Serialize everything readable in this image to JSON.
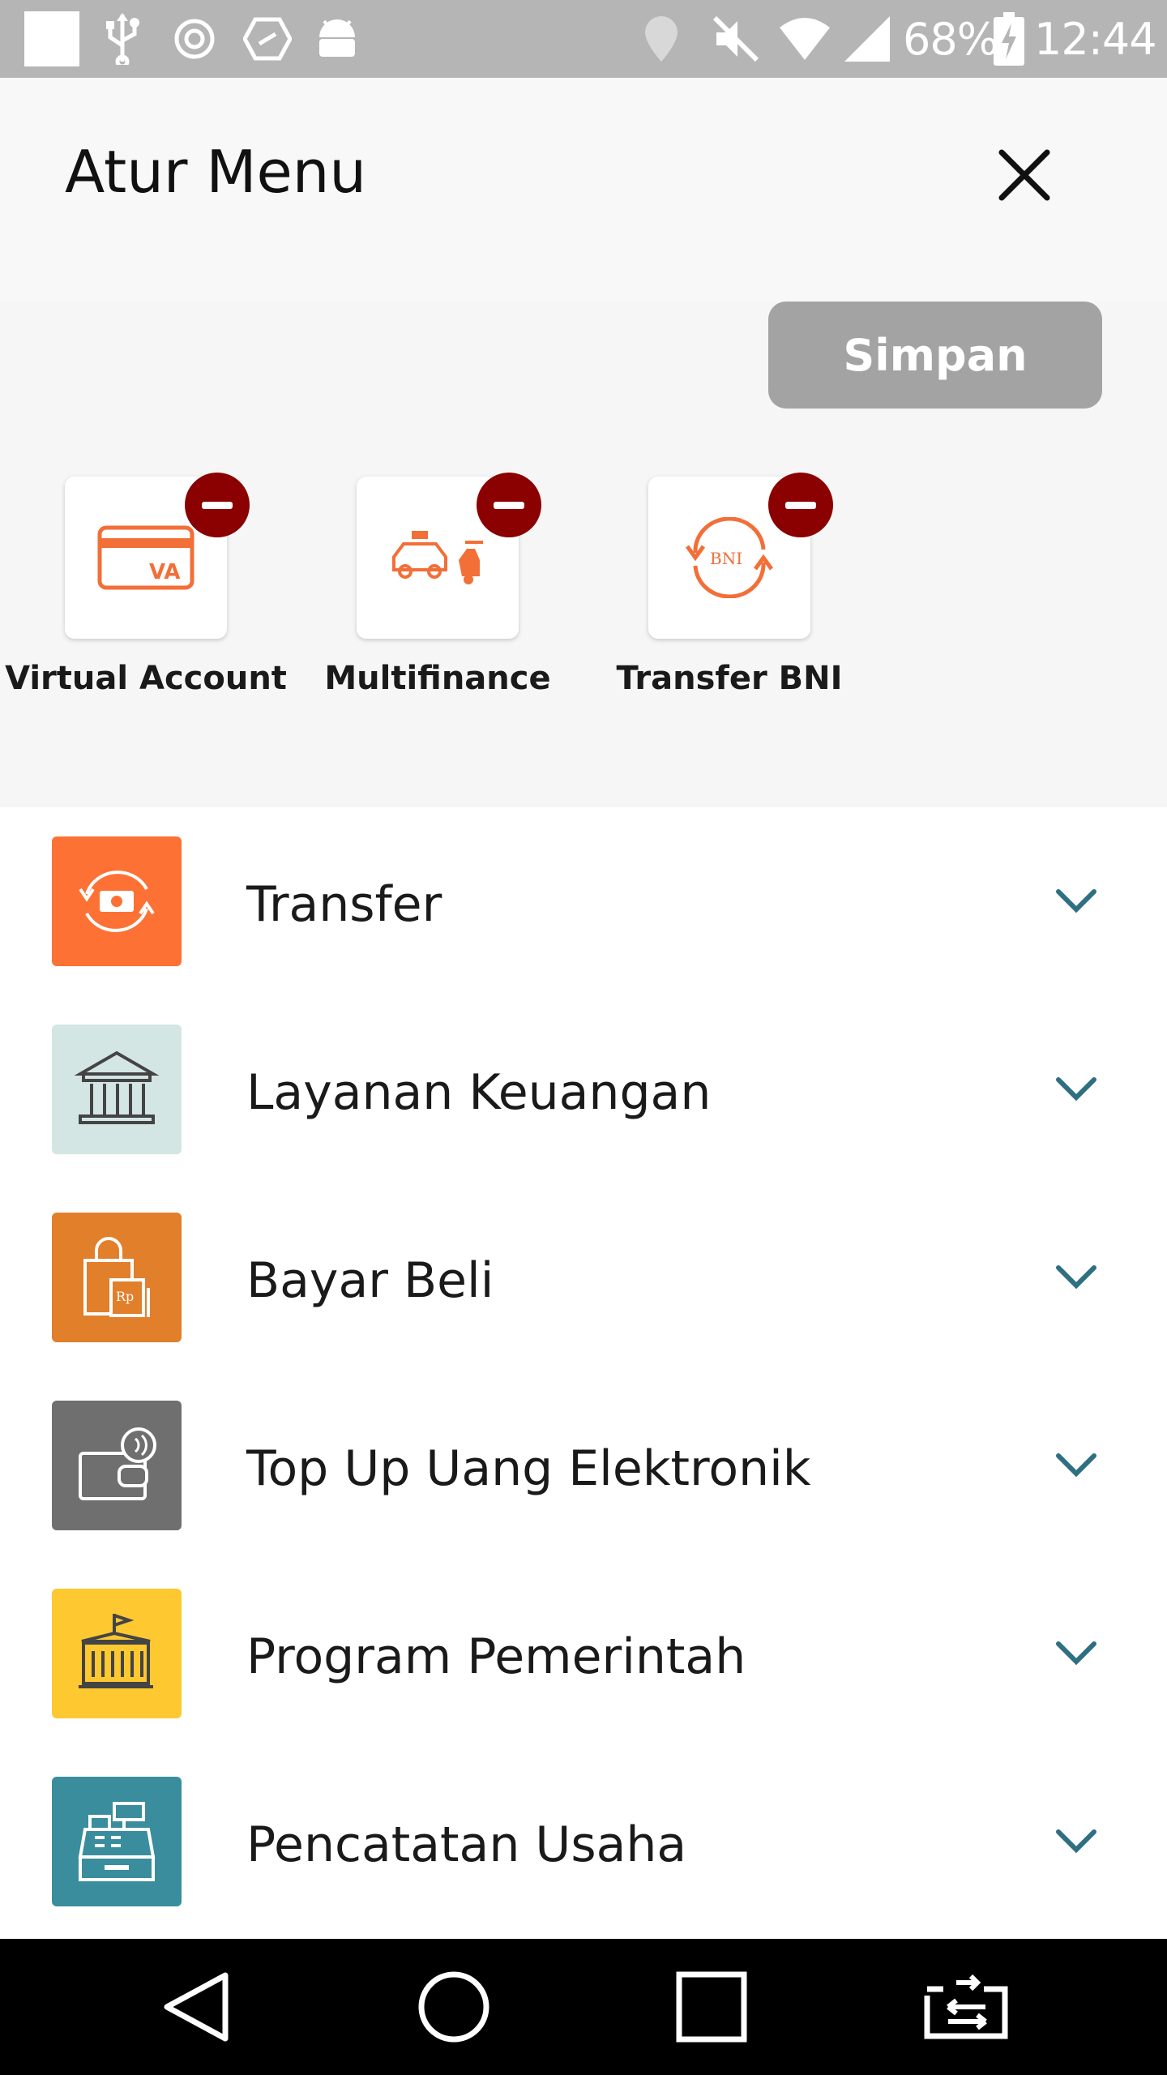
{
  "status_bar": {
    "battery": "68%",
    "time": "12:44",
    "icons_left": [
      "square-icon",
      "usb-icon",
      "gear-icon",
      "shield-icon",
      "android-icon"
    ],
    "icons_right": [
      "location-icon",
      "mute-icon",
      "wifi-icon",
      "signal-icon",
      "battery-charging-icon"
    ]
  },
  "header": {
    "title": "Atur Menu",
    "close_icon": "close-icon"
  },
  "selected_menu": {
    "save_label": "Simpan",
    "items": [
      {
        "label": "Virtual Account",
        "icon": "virtual-account-icon"
      },
      {
        "label": "Multifinance",
        "icon": "multifinance-icon"
      },
      {
        "label": "Transfer BNI",
        "icon": "transfer-bni-icon"
      }
    ]
  },
  "categories": [
    {
      "label": "Transfer",
      "icon": "transfer-icon",
      "color": "#fd7135"
    },
    {
      "label": "Layanan Keuangan",
      "icon": "bank-icon",
      "color": "#d3e6e3"
    },
    {
      "label": "Bayar Beli",
      "icon": "shopping-bag-icon",
      "color": "#e27f2a"
    },
    {
      "label": "Top Up Uang Elektronik",
      "icon": "e-wallet-icon",
      "color": "#6f6f6f"
    },
    {
      "label": "Program Pemerintah",
      "icon": "government-building-icon",
      "color": "#fdc830"
    },
    {
      "label": "Pencatatan Usaha",
      "icon": "cash-register-icon",
      "color": "#3a8d9c"
    }
  ],
  "colors": {
    "accent_orange": "#f26f38",
    "remove_red": "#8b0000",
    "chevron_teal": "#2f6f82",
    "save_button": "#a3a3a3"
  },
  "nav_bar": {
    "icons": [
      "back-icon",
      "home-icon",
      "recents-icon",
      "switch-app-icon"
    ]
  }
}
